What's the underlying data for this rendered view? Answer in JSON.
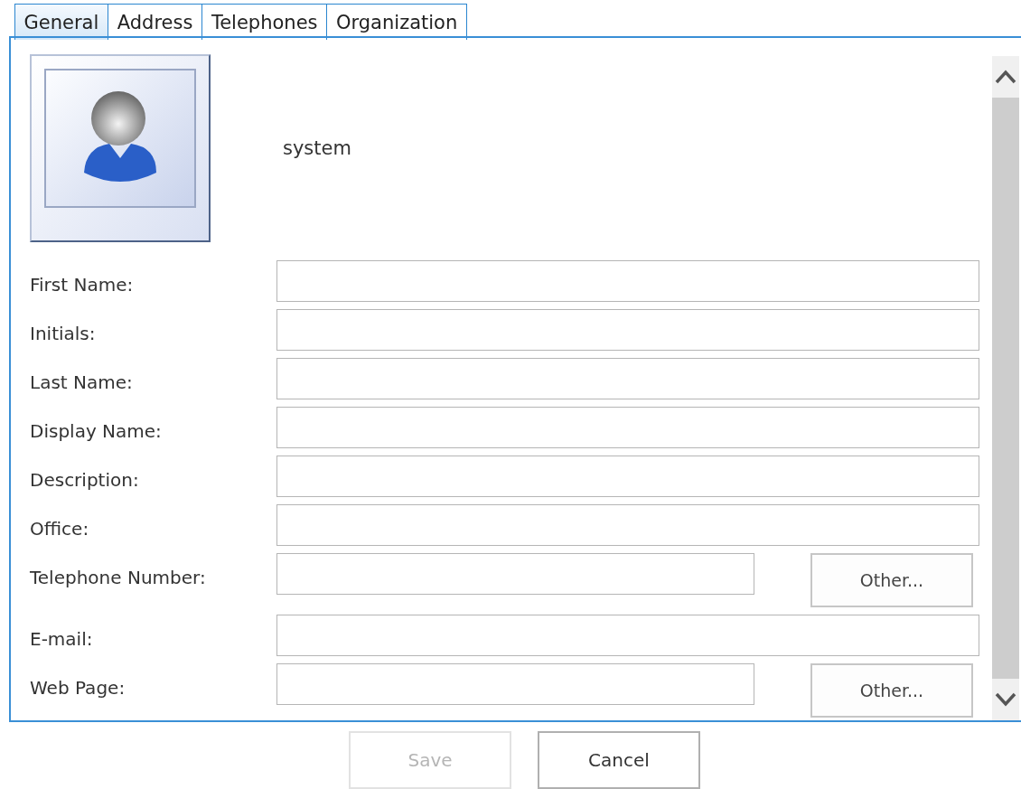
{
  "tabs": [
    {
      "label": "General",
      "selected": true
    },
    {
      "label": "Address",
      "selected": false
    },
    {
      "label": "Telephones",
      "selected": false
    },
    {
      "label": "Organization",
      "selected": false
    }
  ],
  "account_name": "system",
  "fields": [
    {
      "label": "First Name:",
      "kind": "text"
    },
    {
      "label": "Initials:",
      "kind": "text"
    },
    {
      "label": "Last Name:",
      "kind": "text"
    },
    {
      "label": "Display Name:",
      "kind": "text"
    },
    {
      "label": "Description:",
      "kind": "text"
    },
    {
      "label": "Office:",
      "kind": "text"
    },
    {
      "label": "Telephone Number:",
      "kind": "with_button",
      "button": "Other..."
    },
    {
      "label": "E-mail:",
      "kind": "text"
    },
    {
      "label": "Web Page:",
      "kind": "with_button",
      "button": "Other..."
    }
  ],
  "buttons": [
    {
      "label": "Save",
      "disabled": true
    },
    {
      "label": "Cancel",
      "disabled": false
    }
  ]
}
